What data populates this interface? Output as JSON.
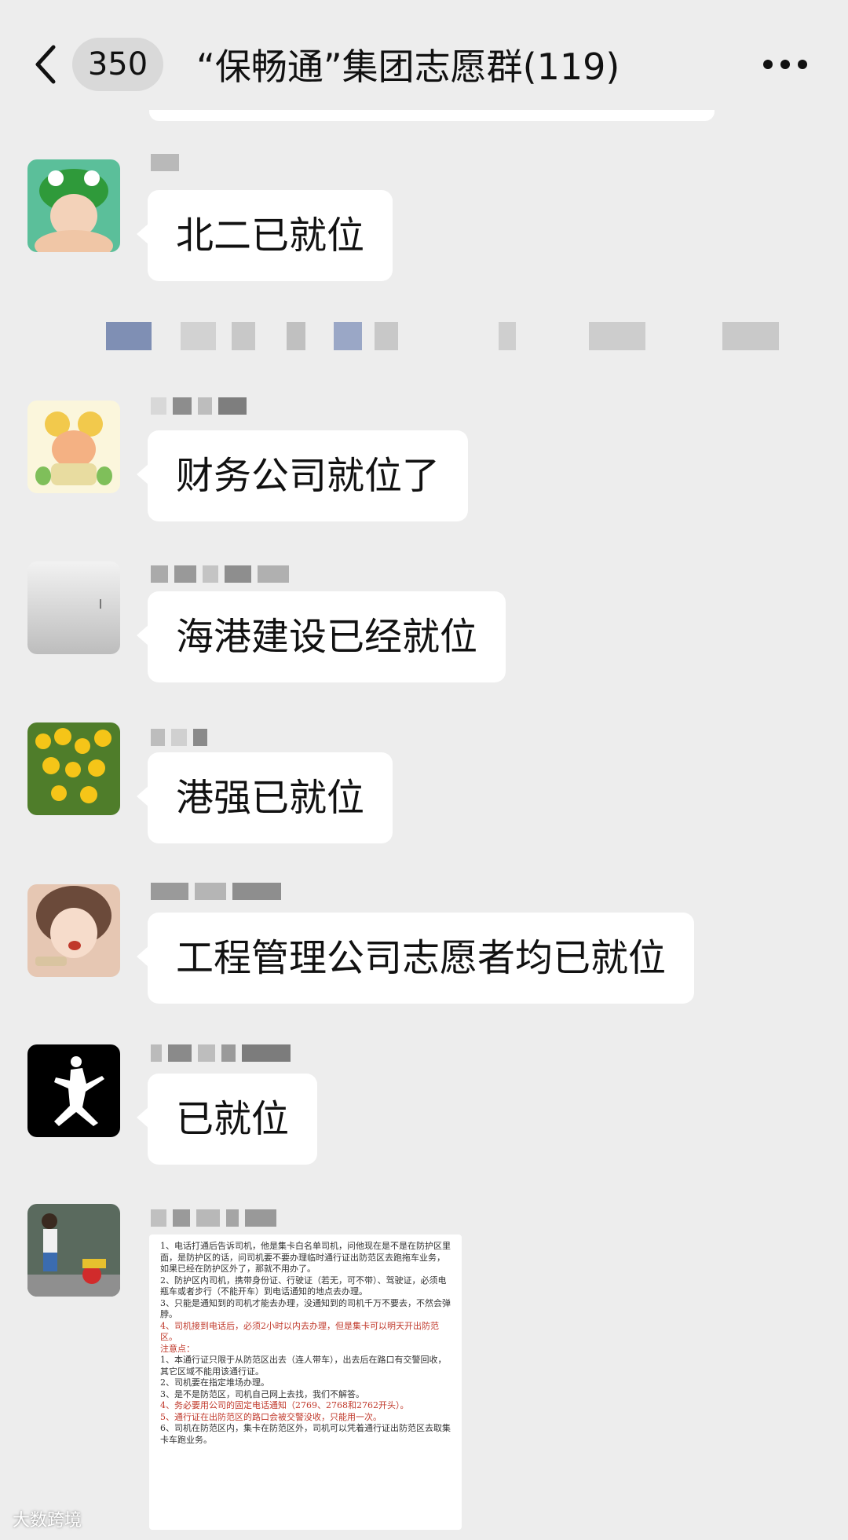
{
  "header": {
    "unread_count": "350",
    "title": "“保畅通”集团志愿群(119)"
  },
  "messages": [
    {
      "text": "北二已就位"
    },
    {
      "text": "财务公司就位了"
    },
    {
      "text": "海港建设已经就位"
    },
    {
      "text": "港强已就位"
    },
    {
      "text": "工程管理公司志愿者均已就位"
    },
    {
      "text": "已就位"
    }
  ],
  "document": {
    "lines": [
      "1、电话打通后告诉司机，他是集卡白名单司机，问他现在是不是在防护区里面，是防护区的话，问司机要不要办理临时通行证出防范区去跑拖车业务，如果已经在防护区外了，那就不用办了。",
      "2、防护区内司机，携带身份证、行驶证（若无，可不带）、驾驶证，必须电瓶车或者步行（不能开车）到电话通知的地点去办理。",
      "3、只能是通知到的司机才能去办理，没通知到的司机千万不要去，不然会弹脖。",
      "4、司机接到电话后，必须2小时以内去办理，但是集卡可以明天开出防范区。",
      "注意点：",
      "1、本通行证只限于从防范区出去（连人带车），出去后在路口有交警回收，其它区域不能用该通行证。",
      "2、司机要在指定堆场办理。",
      "3、是不是防范区，司机自己网上去找，我们不解答。",
      "4、务必要用公司的固定电话通知（2769、2768和2762开头）。",
      "5、通行证在出防范区的路口会被交警没收，只能用一次。",
      "6、司机在防范区内，集卡在防范区外，司机可以凭着通行证出防范区去取集卡车跑业务。"
    ],
    "red_lines": [
      3,
      4,
      8,
      9
    ]
  },
  "watermark": "大数跨境",
  "colors": {
    "background": "#ededed",
    "bubble": "#ffffff",
    "text": "#111111"
  }
}
